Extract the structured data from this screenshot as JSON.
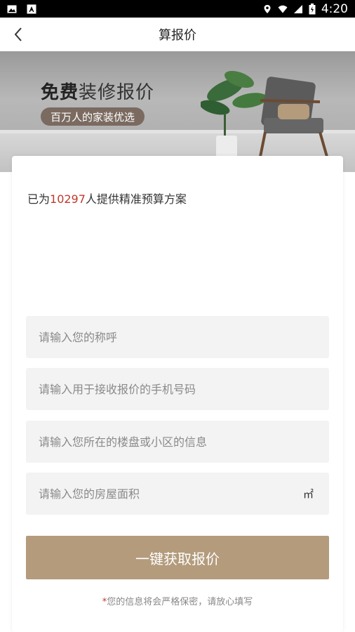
{
  "status_bar": {
    "time": "4:20",
    "icons": [
      "image-icon",
      "text-icon",
      "location-icon",
      "wifi-icon",
      "signal-icon",
      "battery-icon"
    ]
  },
  "header": {
    "title": "算报价",
    "back_icon": "chevron-left-icon"
  },
  "banner": {
    "heading_strong": "免费",
    "heading_rest": "装修报价",
    "pill_text": "百万人的家装优选"
  },
  "tagline": {
    "prefix": "已为",
    "count": "10297",
    "suffix": "人提供精准预算方案"
  },
  "form": {
    "name_placeholder": "请输入您的称呼",
    "phone_placeholder": "请输入用于接收报价的手机号码",
    "community_placeholder": "请输入您所在的楼盘或小区的信息",
    "area_placeholder": "请输入您的房屋面积",
    "area_unit": "㎡",
    "submit_label": "一键获取报价"
  },
  "privacy": {
    "star": "*",
    "text": "您的信息将会严格保密，请放心填写"
  },
  "colors": {
    "accent": "#b39b7c",
    "highlight": "#c0392b",
    "field_bg": "#f3f3f3"
  }
}
